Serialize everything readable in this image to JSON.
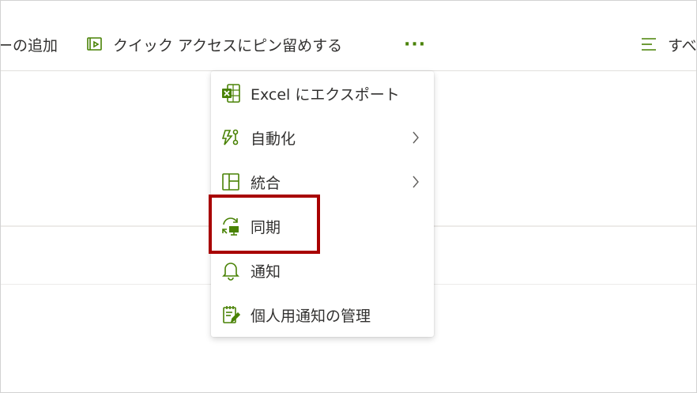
{
  "commandbar": {
    "add_label": "ーの追加",
    "pin_label": "クイック アクセスにピン留めする",
    "more_label": "···",
    "view_label": "すべ"
  },
  "menu": {
    "items": [
      {
        "label": "Excel にエクスポート",
        "icon": "excel-icon",
        "submenu": false
      },
      {
        "label": "自動化",
        "icon": "automate-icon",
        "submenu": true
      },
      {
        "label": "統合",
        "icon": "integrate-icon",
        "submenu": true
      },
      {
        "label": "同期",
        "icon": "sync-icon",
        "submenu": false
      },
      {
        "label": "通知",
        "icon": "bell-icon",
        "submenu": false
      },
      {
        "label": "個人用通知の管理",
        "icon": "manage-notifications-icon",
        "submenu": false
      }
    ]
  },
  "colors": {
    "accent_green": "#498205",
    "highlight_red": "#a80000",
    "text": "#323130"
  }
}
